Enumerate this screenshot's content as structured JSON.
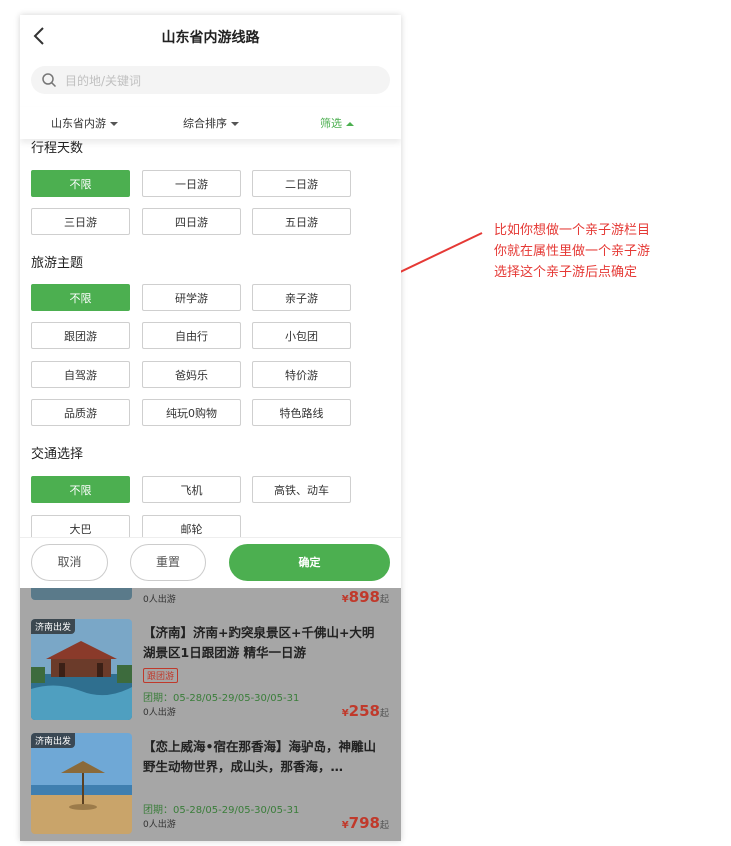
{
  "header": {
    "title": "山东省内游线路"
  },
  "search": {
    "placeholder": "目的地/关键词"
  },
  "sortbar": {
    "items": [
      "山东省内游",
      "综合排序",
      "筛选"
    ]
  },
  "filter": {
    "sections": [
      {
        "title": "行程天数",
        "options": [
          "不限",
          "一日游",
          "二日游",
          "三日游",
          "四日游",
          "五日游"
        ]
      },
      {
        "title": "旅游主题",
        "options": [
          "不限",
          "研学游",
          "亲子游",
          "跟团游",
          "自由行",
          "小包团",
          "自驾游",
          "爸妈乐",
          "特价游",
          "品质游",
          "纯玩0购物",
          "特色路线"
        ]
      },
      {
        "title": "交通选择",
        "options": [
          "不限",
          "飞机",
          "高铁、动车",
          "大巴",
          "邮轮"
        ]
      }
    ]
  },
  "footer": {
    "cancel": "取消",
    "reset": "重置",
    "confirm": "确定"
  },
  "list": {
    "partial_card": {
      "departed": "0人出游",
      "currency": "¥",
      "price": "898",
      "suffix": "起"
    },
    "cards": [
      {
        "depart_tag": "济南出发",
        "title": "【济南】济南+趵突泉景区+千佛山+大明湖景区1日跟团游 精华一日游",
        "badge": "跟团游",
        "period": "团期：05-28/05-29/05-30/05-31",
        "departed": "0人出游",
        "currency": "¥",
        "price": "258",
        "suffix": "起"
      },
      {
        "depart_tag": "济南出发",
        "title": "【恋上威海•宿在那香海】海驴岛，神雕山野生动物世界，成山头，那香海，…",
        "badge": "",
        "period": "团期：05-28/05-29/05-30/05-31",
        "departed": "0人出游",
        "currency": "¥",
        "price": "798",
        "suffix": "起"
      }
    ]
  },
  "annotation": {
    "lines": [
      "比如你想做一个亲子游栏目",
      "你就在属性里做一个亲子游",
      "选择这个亲子游后点确定"
    ]
  },
  "colors": {
    "accent": "#4caf50",
    "price": "#c0392b",
    "annotation": "#e53935"
  },
  "icons": [
    "back-arrow-icon",
    "search-icon",
    "caret-icon"
  ]
}
